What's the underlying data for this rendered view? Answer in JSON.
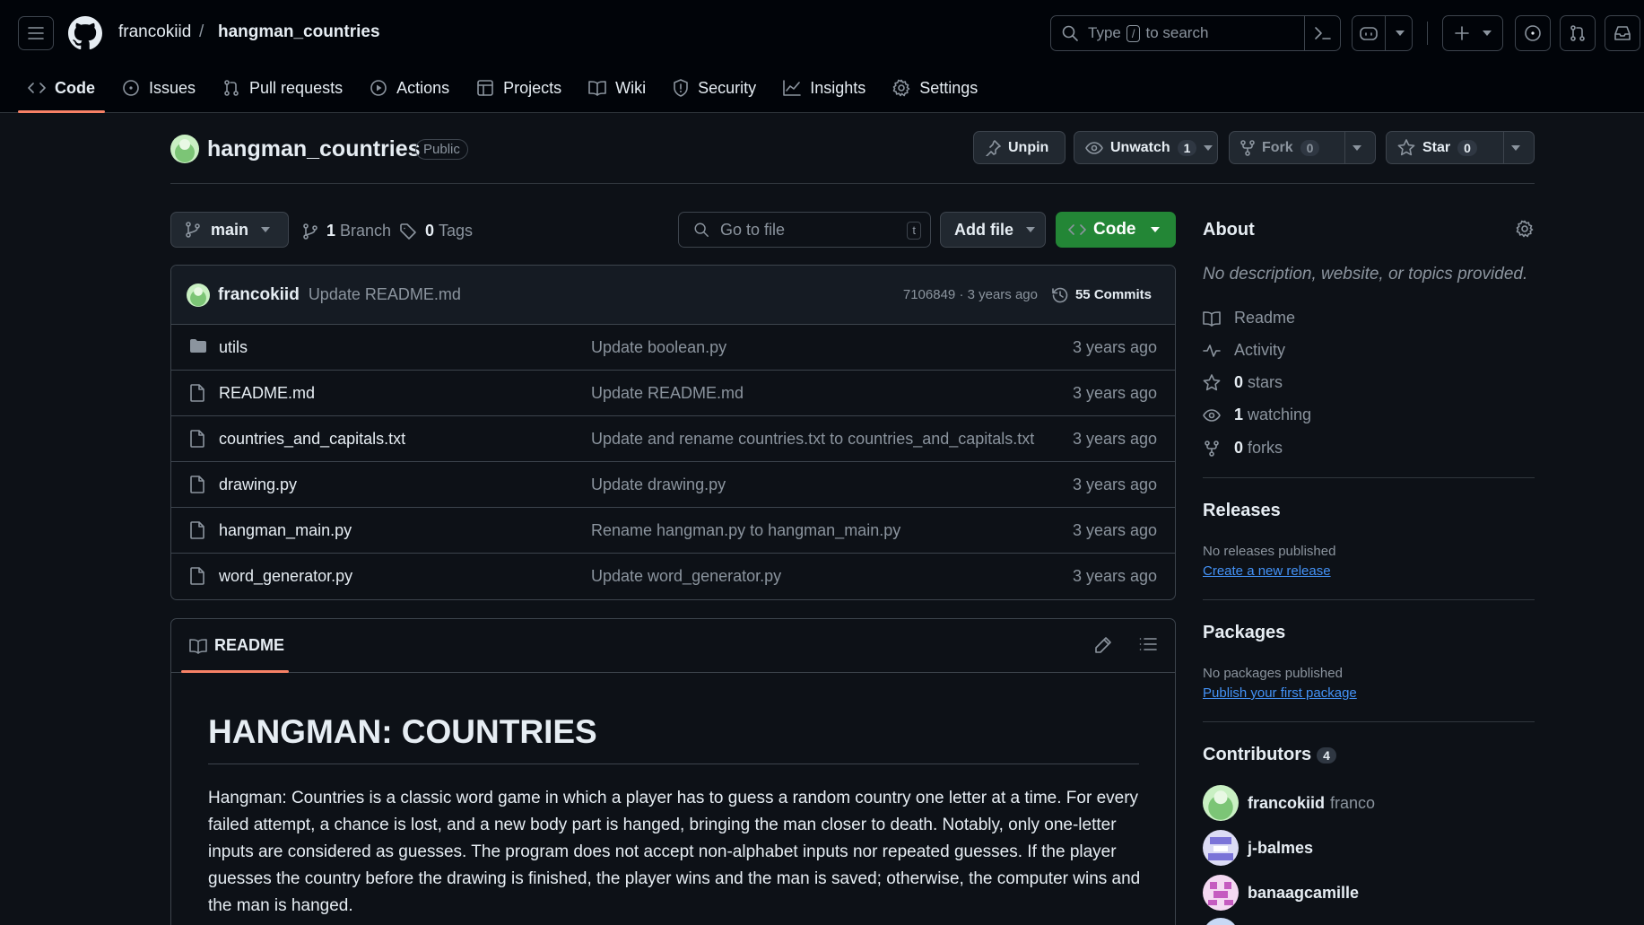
{
  "header": {
    "owner": "francokiid",
    "separator": "/",
    "repo": "hangman_countries",
    "search": {
      "prefix": "Type",
      "key": "/",
      "suffix": "to search"
    }
  },
  "tabs": [
    {
      "label": "Code",
      "icon": "code-icon",
      "active": true
    },
    {
      "label": "Issues",
      "icon": "issue-icon"
    },
    {
      "label": "Pull requests",
      "icon": "pull-request-icon"
    },
    {
      "label": "Actions",
      "icon": "play-icon"
    },
    {
      "label": "Projects",
      "icon": "table-icon"
    },
    {
      "label": "Wiki",
      "icon": "book-icon"
    },
    {
      "label": "Security",
      "icon": "shield-icon"
    },
    {
      "label": "Insights",
      "icon": "graph-icon"
    },
    {
      "label": "Settings",
      "icon": "gear-icon"
    }
  ],
  "repo": {
    "name": "hangman_countries",
    "visibility": "Public",
    "unpin_label": "Unpin",
    "unwatch_label": "Unwatch",
    "watch_count": "1",
    "fork_label": "Fork",
    "fork_count": "0",
    "star_label": "Star",
    "star_count": "0"
  },
  "branch": {
    "name": "main",
    "branch_count": "1",
    "branch_label": "Branch",
    "tag_count": "0",
    "tag_label": "Tags",
    "goto_placeholder": "Go to file",
    "goto_key": "t",
    "add_file_label": "Add file",
    "code_label": "Code"
  },
  "last_commit": {
    "author": "francokiid",
    "message": "Update README.md",
    "sha_time": "7106849 · 3 years ago",
    "commits_label": "55 Commits"
  },
  "files": [
    {
      "name": "utils",
      "type": "folder",
      "message": "Update boolean.py",
      "date": "3 years ago"
    },
    {
      "name": "README.md",
      "type": "file",
      "message": "Update README.md",
      "date": "3 years ago"
    },
    {
      "name": "countries_and_capitals.txt",
      "type": "file",
      "message": "Update and rename countries.txt to countries_and_capitals.txt",
      "date": "3 years ago"
    },
    {
      "name": "drawing.py",
      "type": "file",
      "message": "Update drawing.py",
      "date": "3 years ago"
    },
    {
      "name": "hangman_main.py",
      "type": "file",
      "message": "Rename hangman.py to hangman_main.py",
      "date": "3 years ago"
    },
    {
      "name": "word_generator.py",
      "type": "file",
      "message": "Update word_generator.py",
      "date": "3 years ago"
    }
  ],
  "readme": {
    "tab_label": "README",
    "heading": "HANGMAN: COUNTRIES",
    "body": "Hangman: Countries is a classic word game in which a player has to guess a random country one letter at a time. For every failed attempt, a chance is lost, and a new body part is hanged, bringing the man closer to death. Notably, only one-letter inputs are considered as guesses. The program does not accept non-alphabet inputs nor repeated guesses. If the player guesses the country before the drawing is finished, the player wins and the man is saved; otherwise, the computer wins and the man is hanged."
  },
  "about": {
    "title": "About",
    "description": "No description, website, or topics provided.",
    "readme_label": "Readme",
    "activity_label": "Activity",
    "stars_count": "0",
    "stars_label": "stars",
    "watching_count": "1",
    "watching_label": "watching",
    "forks_count": "0",
    "forks_label": "forks"
  },
  "releases": {
    "title": "Releases",
    "subtitle": "No releases published",
    "link": "Create a new release"
  },
  "packages": {
    "title": "Packages",
    "subtitle": "No packages published",
    "link": "Publish your first package"
  },
  "contributors": {
    "title": "Contributors",
    "count": "4",
    "list": [
      {
        "login": "francokiid",
        "name": "franco"
      },
      {
        "login": "j-balmes",
        "name": ""
      },
      {
        "login": "banaagcamille",
        "name": ""
      }
    ]
  },
  "colors": {
    "background": "#0d1117",
    "header": "#010409",
    "accent_tab": "#f78166",
    "green_button": "#238636",
    "link": "#4493f8"
  }
}
